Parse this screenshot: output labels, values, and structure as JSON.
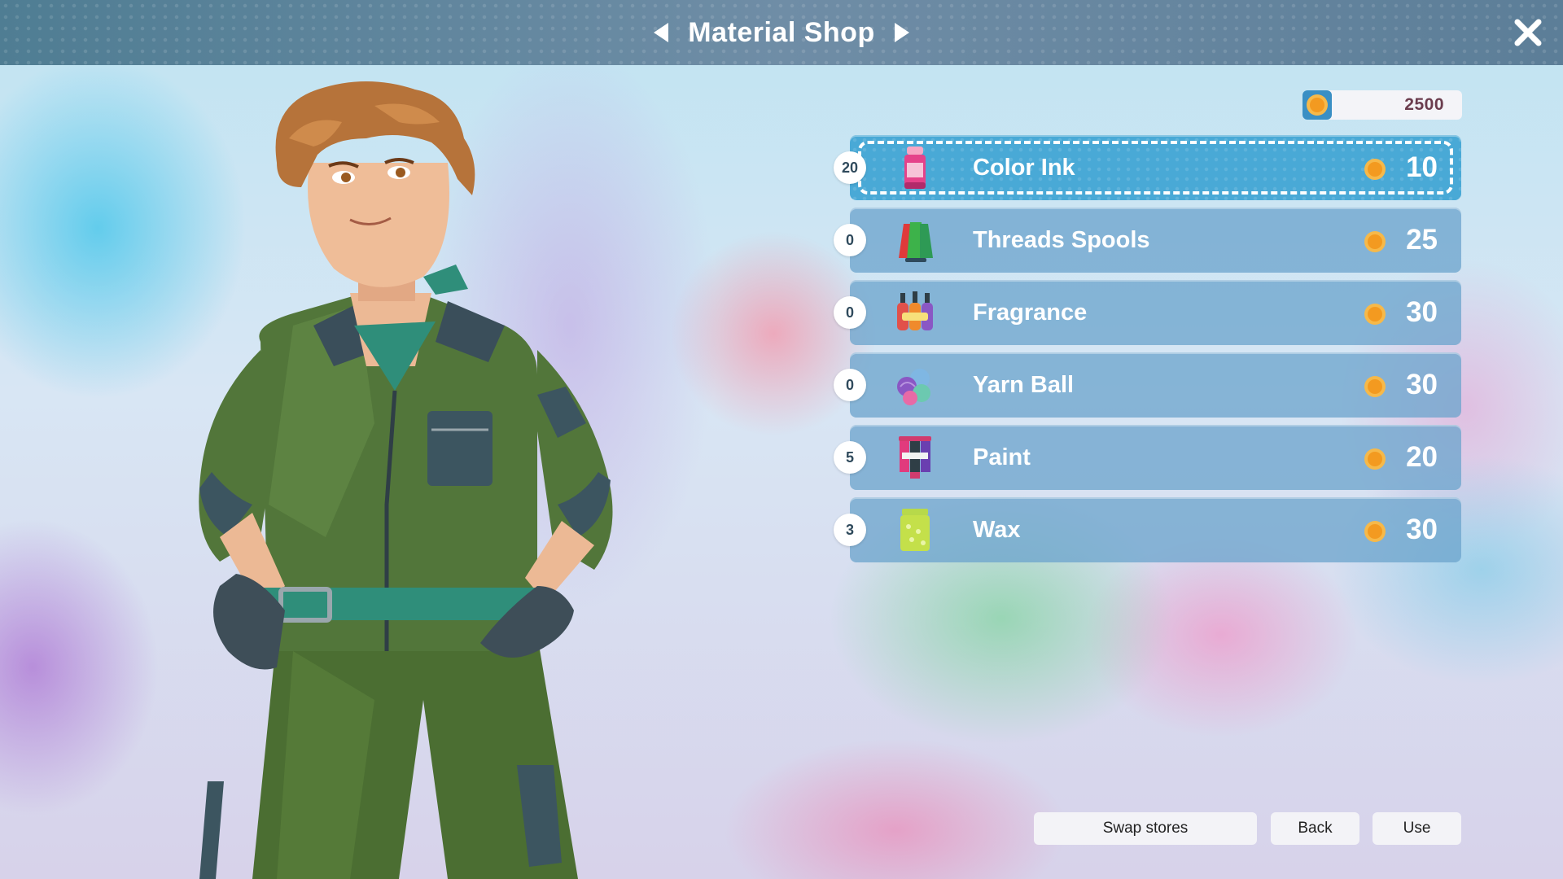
{
  "header": {
    "title": "Material Shop"
  },
  "wallet": {
    "coins": "2500"
  },
  "items": [
    {
      "quantity": "20",
      "name": "Color Ink",
      "price": "10",
      "icon": "color-ink-bottle-icon",
      "selected": true
    },
    {
      "quantity": "0",
      "name": "Threads Spools",
      "price": "25",
      "icon": "thread-spools-icon",
      "selected": false
    },
    {
      "quantity": "0",
      "name": "Fragrance",
      "price": "30",
      "icon": "fragrance-bottles-icon",
      "selected": false
    },
    {
      "quantity": "0",
      "name": "Yarn Ball",
      "price": "30",
      "icon": "yarn-ball-icon",
      "selected": false
    },
    {
      "quantity": "5",
      "name": "Paint",
      "price": "20",
      "icon": "paint-tubes-icon",
      "selected": false
    },
    {
      "quantity": "3",
      "name": "Wax",
      "price": "30",
      "icon": "wax-jar-icon",
      "selected": false
    }
  ],
  "buttons": {
    "swap": "Swap stores",
    "back": "Back",
    "use": "Use"
  },
  "colors": {
    "topbar": "#5f86a0",
    "row": "#6ea5cd",
    "row_selected": "#49a9d6",
    "coin": "#f4a52e",
    "balance_text": "#6b3d4e"
  }
}
